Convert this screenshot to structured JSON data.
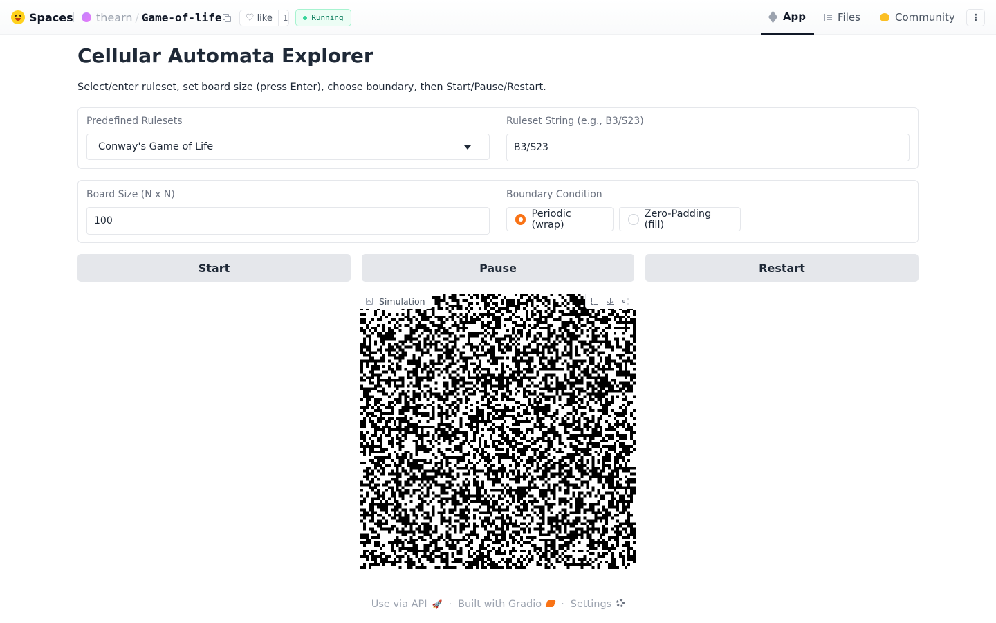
{
  "header": {
    "brand": "Spaces",
    "owner": "thearn",
    "repo": "Game-of-life",
    "like_label": "like",
    "like_count": "1",
    "status": "Running",
    "nav": [
      {
        "label": "App",
        "icon": "app-icon",
        "active": true
      },
      {
        "label": "Files",
        "icon": "files-icon"
      },
      {
        "label": "Community",
        "icon": "community-icon"
      }
    ]
  },
  "main": {
    "title": "Cellular Automata Explorer",
    "description": "Select/enter ruleset, set board size (press Enter), choose boundary, then Start/Pause/Restart.",
    "rulesets": {
      "label": "Predefined Rulesets",
      "selected": "Conway's Game of Life"
    },
    "ruleset_string": {
      "label": "Ruleset String (e.g., B3/S23)",
      "value": "B3/S23"
    },
    "board_size": {
      "label": "Board Size (N x N)",
      "value": "100"
    },
    "boundary": {
      "label": "Boundary Condition",
      "options": [
        {
          "label": "Periodic (wrap)",
          "checked": true
        },
        {
          "label": "Zero-Padding (fill)",
          "checked": false
        }
      ]
    },
    "buttons": {
      "start": "Start",
      "pause": "Pause",
      "restart": "Restart"
    },
    "simulation": {
      "label": "Simulation",
      "alive_color": "#000000",
      "dead_color": "#ffffff"
    }
  },
  "footer": {
    "api": "Use via API",
    "built": "Built with Gradio",
    "settings": "Settings",
    "separator": "·"
  },
  "colors": {
    "accent": "#f97316",
    "status_green": "#047857"
  }
}
